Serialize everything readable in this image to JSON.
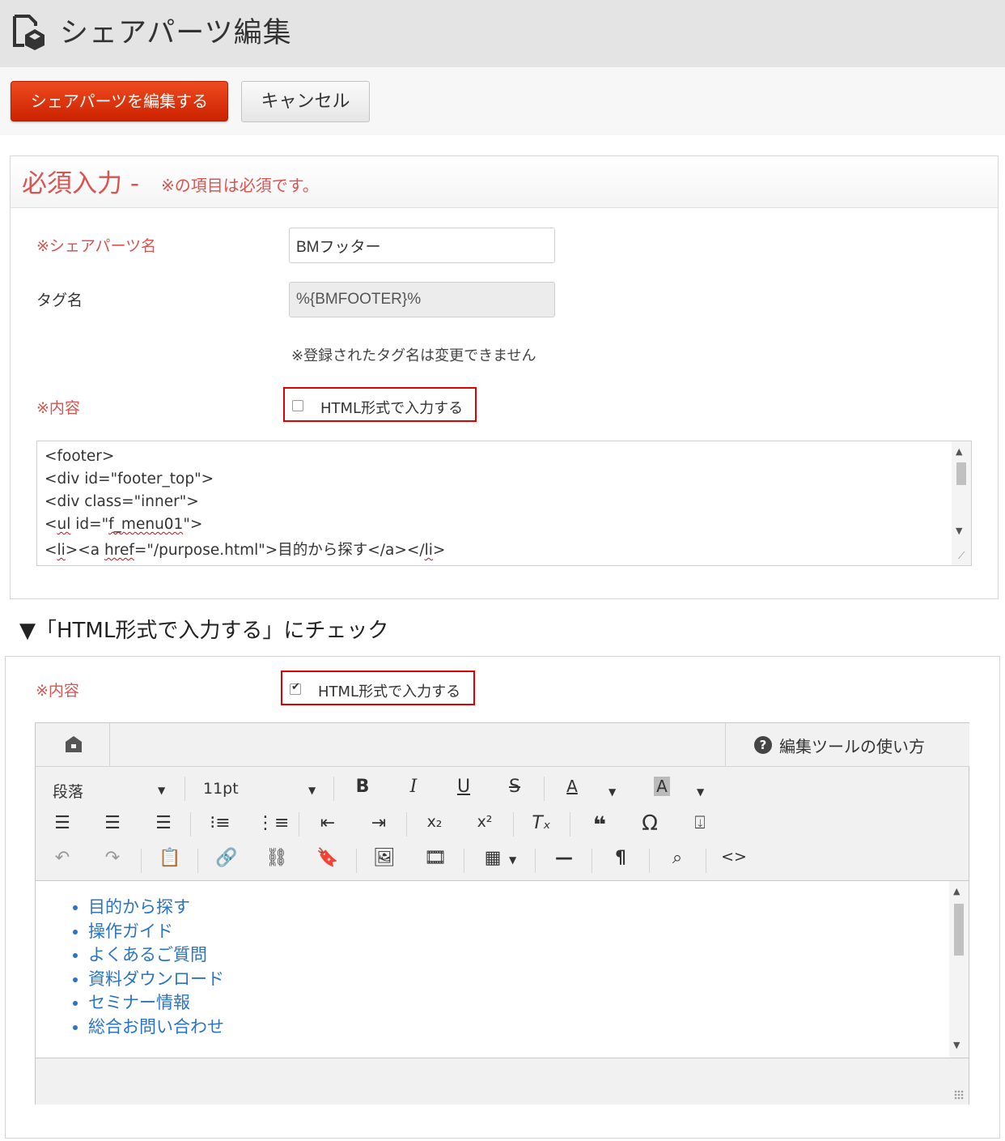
{
  "header": {
    "title": "シェアパーツ編集",
    "icon": "share-parts-logo-icon"
  },
  "toolbar": {
    "submit_label": "シェアパーツを編集する",
    "cancel_label": "キャンセル"
  },
  "required_section": {
    "title": "必須入力 -",
    "note": "※の項目は必須です。",
    "fields": {
      "name_label": "※シェアパーツ名",
      "name_value": "BMフッター",
      "tag_label": "タグ名",
      "tag_value": "%{BMFOOTER}%",
      "tag_note": "※登録されたタグ名は変更できません",
      "content_label": "※内容",
      "html_checkbox_label": "HTML形式で入力する",
      "html_checked": false
    },
    "code_lines": [
      "<footer>",
      "<div id=\"footer_top\">",
      "<div class=\"inner\">"
    ],
    "code_line4": {
      "a": "<",
      "b": "ul",
      "c": " id=\"",
      "d": "f_menu01",
      "e": "\">"
    },
    "code_line5": {
      "a": "<",
      "b": "li",
      "c": "><a ",
      "d": "href",
      "e": "=\"/purpose.html\">目的から探す</a></",
      "f": "li",
      "g": ">"
    }
  },
  "caption": "▼「HTML形式で入力する」にチェック",
  "second_section": {
    "content_label": "※内容",
    "html_checkbox_label": "HTML形式で入力する",
    "html_checked": true,
    "editor": {
      "help_label": "編集ツールの使い方",
      "format_value": "段落",
      "size_value": "11pt",
      "links": [
        "目的から探す",
        "操作ガイド",
        "よくあるご質問",
        "資料ダウンロード",
        "セミナー情報",
        "総合お問い合わせ"
      ]
    }
  },
  "colors": {
    "required": "#d9534f",
    "primary_button": "#dd3311",
    "link": "#2a73c5",
    "highlight_border": "#e10000"
  }
}
